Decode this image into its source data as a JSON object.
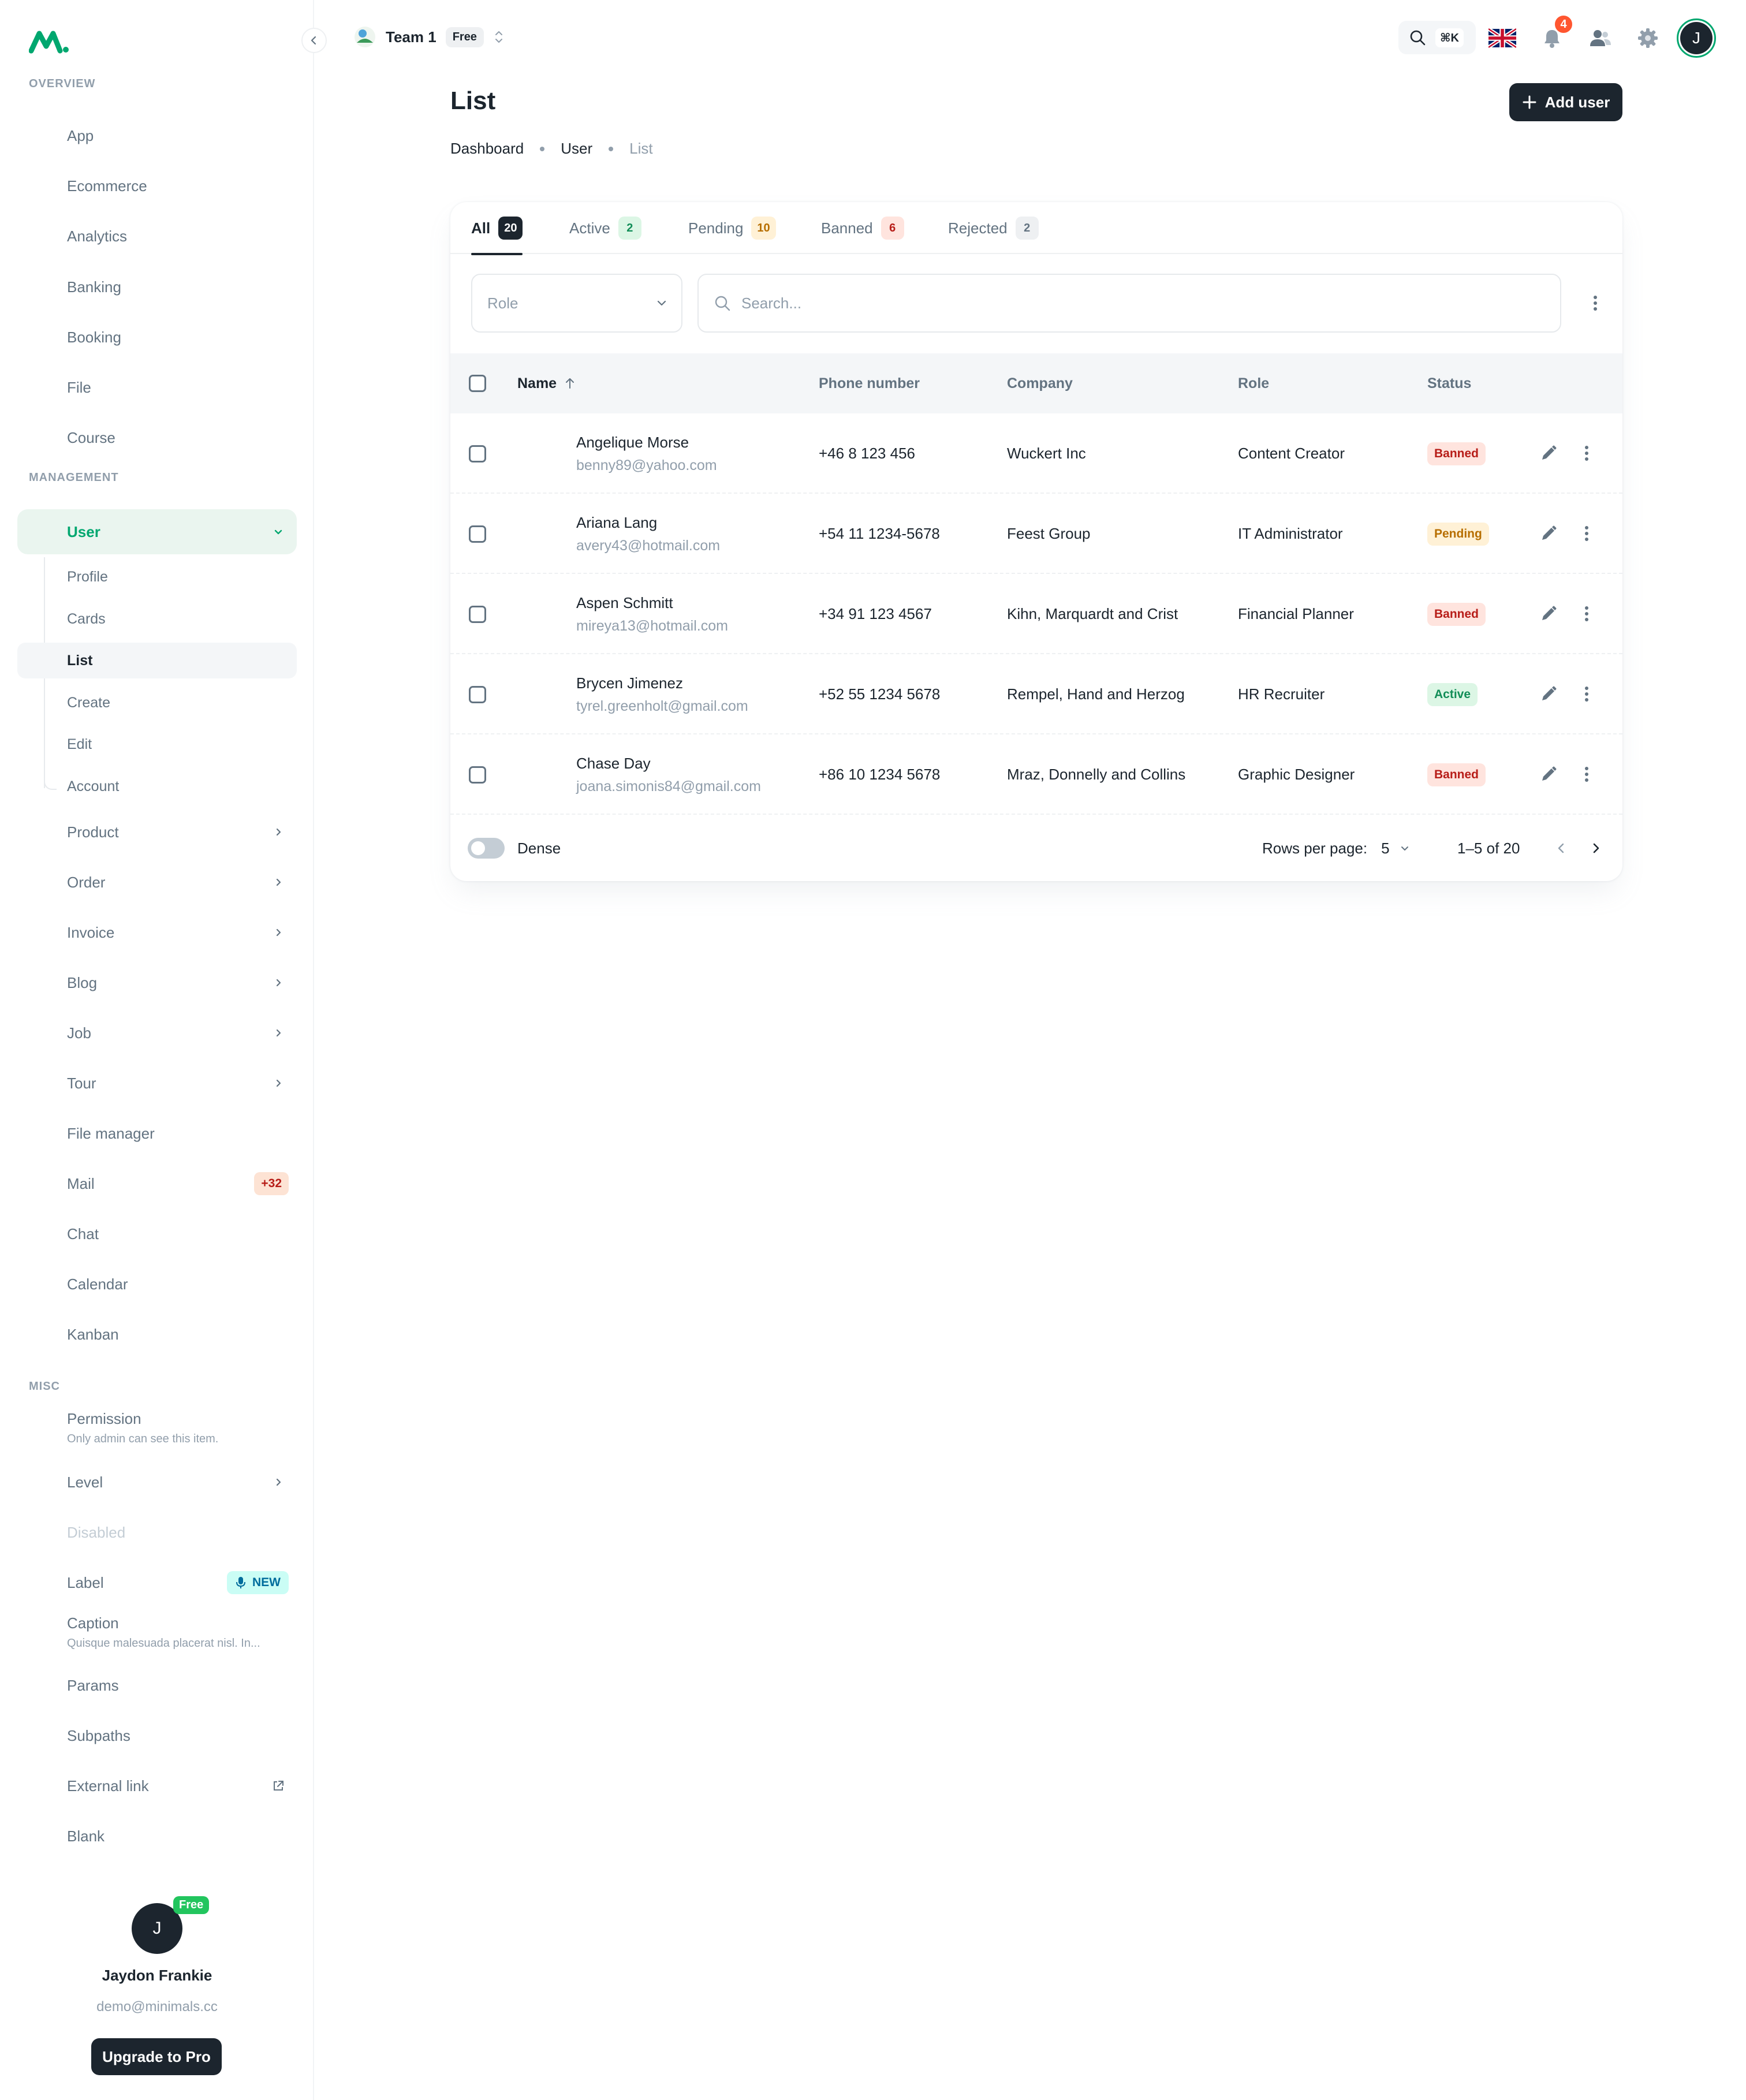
{
  "sidebar": {
    "sections": {
      "overview": "OVERVIEW",
      "management": "MANAGEMENT",
      "misc": "MISC"
    },
    "overview_items": [
      "App",
      "Ecommerce",
      "Analytics",
      "Banking",
      "Booking",
      "File",
      "Course"
    ],
    "user_menu": {
      "label": "User",
      "children": [
        "Profile",
        "Cards",
        "List",
        "Create",
        "Edit",
        "Account"
      ],
      "current": "List"
    },
    "management_items": [
      "Product",
      "Order",
      "Invoice",
      "Blog",
      "Job",
      "Tour",
      "File manager",
      "Mail",
      "Chat",
      "Calendar",
      "Kanban"
    ],
    "mail_badge": "+32",
    "misc": {
      "permission": {
        "label": "Permission",
        "caption": "Only admin can see this item."
      },
      "level": "Level",
      "disabled": "Disabled",
      "label": "Label",
      "label_badge": "NEW",
      "caption": {
        "label": "Caption",
        "caption": "Quisque malesuada placerat nisl. In..."
      },
      "params": "Params",
      "subpaths": "Subpaths",
      "external_link": "External link",
      "blank": "Blank"
    },
    "profile": {
      "initial": "J",
      "plan": "Free",
      "name": "Jaydon Frankie",
      "email": "demo@minimals.cc",
      "upgrade": "Upgrade to Pro"
    }
  },
  "header": {
    "team": "Team 1",
    "plan": "Free",
    "search_shortcut": "⌘K",
    "notifications": "4",
    "avatar_initial": "J"
  },
  "page": {
    "title": "List",
    "add_button": "Add user",
    "breadcrumb": [
      "Dashboard",
      "User",
      "List"
    ]
  },
  "tabs": [
    {
      "label": "All",
      "count": "20"
    },
    {
      "label": "Active",
      "count": "2"
    },
    {
      "label": "Pending",
      "count": "10"
    },
    {
      "label": "Banned",
      "count": "6"
    },
    {
      "label": "Rejected",
      "count": "2"
    }
  ],
  "filters": {
    "role_placeholder": "Role",
    "search_placeholder": "Search..."
  },
  "table": {
    "columns": {
      "name": "Name",
      "phone": "Phone number",
      "company": "Company",
      "role": "Role",
      "status": "Status"
    },
    "rows": [
      {
        "name": "Angelique Morse",
        "email": "benny89@yahoo.com",
        "phone": "+46 8 123 456",
        "company": "Wuckert Inc",
        "role": "Content Creator",
        "status": "Banned"
      },
      {
        "name": "Ariana Lang",
        "email": "avery43@hotmail.com",
        "phone": "+54 11 1234-5678",
        "company": "Feest Group",
        "role": "IT Administrator",
        "status": "Pending"
      },
      {
        "name": "Aspen Schmitt",
        "email": "mireya13@hotmail.com",
        "phone": "+34 91 123 4567",
        "company": "Kihn, Marquardt and Crist",
        "role": "Financial Planner",
        "status": "Banned"
      },
      {
        "name": "Brycen Jimenez",
        "email": "tyrel.greenholt@gmail.com",
        "phone": "+52 55 1234 5678",
        "company": "Rempel, Hand and Herzog",
        "role": "HR Recruiter",
        "status": "Active"
      },
      {
        "name": "Chase Day",
        "email": "joana.simonis84@gmail.com",
        "phone": "+86 10 1234 5678",
        "company": "Mraz, Donnelly and Collins",
        "role": "Graphic Designer",
        "status": "Banned"
      }
    ]
  },
  "footer": {
    "dense": "Dense",
    "rows_per_page": "Rows per page:",
    "rows_value": "5",
    "range": "1–5 of 20"
  },
  "colors": {
    "primary": "#00a76f",
    "dark": "#1c252e",
    "muted": "#637381",
    "banned": "#b71d18",
    "pending": "#b76e00",
    "active": "#118d57"
  }
}
